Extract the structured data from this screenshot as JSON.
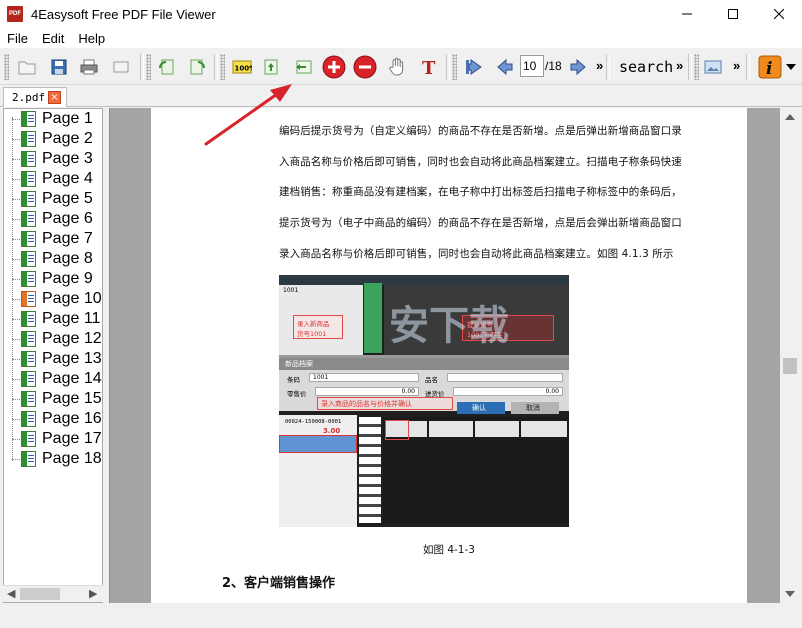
{
  "window": {
    "title": "4Easysoft Free PDF File Viewer",
    "app_icon_label": "PDF"
  },
  "menu": {
    "items": [
      "File",
      "Edit",
      "Help"
    ]
  },
  "toolbar": {
    "page_current": "10",
    "page_total": "/18",
    "search_label": "search",
    "overflow": "»",
    "zoom_fit_label": "100%"
  },
  "tabs": [
    {
      "label": "2.pdf",
      "close": "×"
    }
  ],
  "sidebar": {
    "pages": [
      {
        "label": "Page 1",
        "highlight": false
      },
      {
        "label": "Page 2",
        "highlight": false
      },
      {
        "label": "Page 3",
        "highlight": false
      },
      {
        "label": "Page 4",
        "highlight": false
      },
      {
        "label": "Page 5",
        "highlight": false
      },
      {
        "label": "Page 6",
        "highlight": false
      },
      {
        "label": "Page 7",
        "highlight": false
      },
      {
        "label": "Page 8",
        "highlight": false
      },
      {
        "label": "Page 9",
        "highlight": false
      },
      {
        "label": "Page 10",
        "highlight": true
      },
      {
        "label": "Page 11",
        "highlight": false
      },
      {
        "label": "Page 12",
        "highlight": false
      },
      {
        "label": "Page 13",
        "highlight": false
      },
      {
        "label": "Page 14",
        "highlight": false
      },
      {
        "label": "Page 15",
        "highlight": false
      },
      {
        "label": "Page 16",
        "highlight": false
      },
      {
        "label": "Page 17",
        "highlight": false
      },
      {
        "label": "Page 18",
        "highlight": false
      }
    ]
  },
  "document": {
    "lines": [
      "编码后提示货号为（自定义编码）的商品不存在是否新增。点是后弹出新增商品窗口录",
      "入商品名称与价格后即可销售，同时也会自动将此商品档案建立。扫描电子称条码快速",
      "建档销售：称重商品没有建档案，在电子称中打出标签后扫描电子称标签中的条码后，",
      "提示货号为（电子中商品的编码）的商品不存在是否新增，点是后会弹出新增商品窗口",
      "录入商品名称与价格后即可销售，同时也会自动将此商品档案建立。如图 4.1.3 所示"
    ],
    "caption": "如图 4-1-3",
    "section_heading": "2、客户端销售操作",
    "screenshot": {
      "watermark": "安下载",
      "top_label": "1001",
      "left_note": "录入新商品\n货号1001",
      "form_title": "新品档案",
      "field_barcode_label": "条码",
      "field_barcode_value": "1001",
      "field_name_label": "品名",
      "field_price_label": "零售价",
      "field_price_value": "0.00",
      "field_cost_label": "进货价",
      "field_cost_value": "0.00",
      "form_note": "录入商品的品名与价格并确认",
      "ok_button": "确认",
      "cancel_button": "取消",
      "receipt_amount": "3.00",
      "receipt_code": "00024-150008-0001",
      "right_note": "提示货号\n1001不存在"
    }
  },
  "colors": {
    "accent_red": "#d8232a",
    "page_icon_green": "#2f8f2f",
    "page_icon_orange": "#e3732b",
    "viewer_background": "#a5a5a5"
  }
}
